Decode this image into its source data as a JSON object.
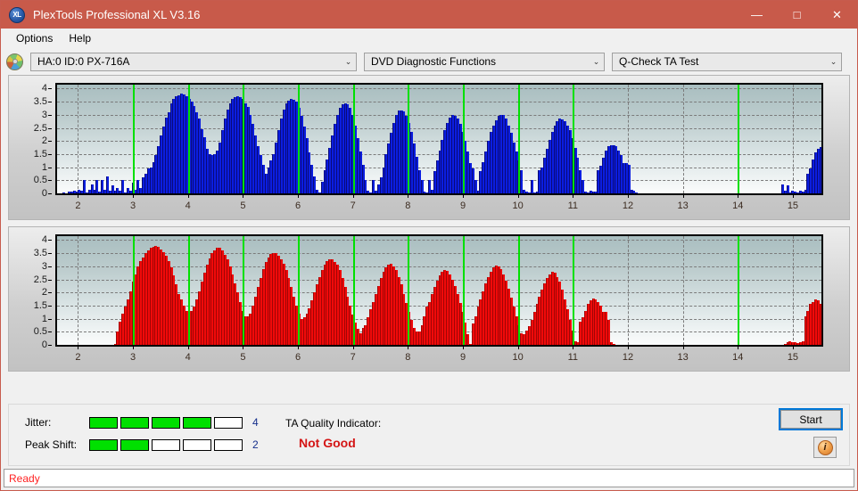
{
  "window": {
    "title": "PlexTools Professional XL V3.16",
    "icon": "app-xl-icon",
    "minimize": "—",
    "maximize": "□",
    "close": "✕"
  },
  "menubar": {
    "items": [
      {
        "label": "Options"
      },
      {
        "label": "Help"
      }
    ]
  },
  "selectors": {
    "drive": {
      "value": "HA:0 ID:0  PX-716A",
      "arrow": "⌄"
    },
    "function": {
      "value": "DVD Diagnostic Functions",
      "arrow": "⌄"
    },
    "test": {
      "value": "Q-Check TA Test",
      "arrow": "⌄"
    }
  },
  "chart_data": [
    {
      "type": "bar",
      "name": "ta-test-chart-jitter",
      "title": "",
      "xlabel": "",
      "ylabel": "",
      "color": "#0b1ee0",
      "xlim": [
        1.62,
        15.52
      ],
      "ylim": [
        0,
        4.15
      ],
      "yticks": [
        0,
        0.5,
        1,
        1.5,
        2,
        2.5,
        3,
        3.5,
        4
      ],
      "ytick_labels": [
        "0",
        "0.5",
        "1",
        "1.5",
        "2",
        "2.5",
        "3",
        "3.5",
        "4"
      ],
      "xticks": [
        2,
        3,
        4,
        5,
        6,
        7,
        8,
        9,
        10,
        11,
        12,
        13,
        14,
        15
      ],
      "xtick_labels": [
        "2",
        "3",
        "4",
        "5",
        "6",
        "7",
        "8",
        "9",
        "10",
        "11",
        "12",
        "13",
        "14",
        "15"
      ],
      "grid": true,
      "markers": [
        3,
        4,
        5,
        6,
        7,
        8,
        9,
        10,
        11,
        14
      ],
      "marker_color": "#00e000",
      "x_start": 1.72,
      "x_step": 0.0465,
      "values": [
        0.05,
        0.0,
        0.08,
        0.06,
        0.1,
        0.07,
        0.12,
        0.1,
        0.5,
        0.05,
        0.12,
        0.35,
        0.15,
        0.5,
        0.08,
        0.5,
        0.12,
        0.65,
        0.1,
        0.32,
        0.1,
        0.2,
        0.1,
        0.5,
        0.05,
        0.2,
        0.1,
        0.4,
        0.12,
        0.5,
        0.2,
        0.6,
        0.75,
        0.95,
        1.0,
        1.2,
        1.45,
        1.8,
        2.2,
        2.55,
        2.9,
        3.1,
        3.45,
        3.6,
        3.7,
        3.75,
        3.8,
        3.78,
        3.7,
        3.6,
        3.5,
        3.35,
        3.1,
        2.85,
        2.45,
        2.15,
        1.7,
        1.5,
        1.45,
        1.5,
        1.65,
        1.95,
        2.4,
        2.85,
        3.2,
        3.45,
        3.6,
        3.68,
        3.7,
        3.68,
        3.6,
        3.45,
        3.3,
        3.0,
        2.65,
        2.2,
        1.8,
        1.45,
        1.1,
        0.75,
        1.0,
        1.25,
        1.5,
        1.95,
        2.4,
        2.85,
        3.2,
        3.45,
        3.55,
        3.6,
        3.58,
        3.5,
        3.25,
        2.95,
        2.55,
        2.1,
        1.55,
        1.1,
        0.65,
        0.15,
        0.05,
        0.45,
        0.9,
        1.3,
        1.75,
        2.2,
        2.65,
        3.0,
        3.25,
        3.4,
        3.45,
        3.4,
        3.25,
        3.0,
        2.6,
        2.1,
        1.6,
        1.1,
        0.5,
        0.1,
        0.05,
        0.5,
        0.1,
        0.35,
        0.6,
        1.0,
        1.5,
        1.9,
        2.3,
        2.7,
        3.0,
        3.15,
        3.18,
        3.12,
        2.95,
        2.7,
        2.35,
        1.9,
        1.4,
        0.9,
        0.5,
        0.08,
        0.05,
        0.5,
        0.15,
        0.85,
        1.25,
        1.65,
        2.05,
        2.4,
        2.7,
        2.9,
        2.98,
        2.95,
        2.85,
        2.65,
        2.35,
        2.0,
        1.6,
        1.15,
        0.95,
        0.5,
        0.1,
        0.85,
        1.2,
        1.6,
        2.0,
        2.35,
        2.6,
        2.8,
        2.95,
        3.0,
        2.98,
        2.85,
        2.6,
        2.3,
        1.95,
        1.6,
        1.25,
        0.9,
        0.15,
        0.08,
        0.05,
        0.5,
        0.05,
        0.08,
        0.9,
        1.0,
        1.35,
        1.7,
        2.05,
        2.35,
        2.6,
        2.75,
        2.85,
        2.82,
        2.75,
        2.6,
        2.4,
        2.1,
        1.75,
        1.35,
        0.9,
        0.5,
        0.08,
        0.05,
        0.1,
        0.06,
        0.08,
        0.9,
        1.05,
        1.35,
        1.65,
        1.8,
        1.85,
        1.85,
        1.8,
        1.65,
        1.45,
        1.15,
        1.15,
        1.1,
        0.15,
        0.1,
        0.05,
        0.0,
        0.0,
        0.0,
        0.0,
        0.0,
        0.0,
        0.0,
        0.0,
        0.0,
        0.0,
        0.0,
        0.0,
        0.0,
        0.0,
        0.0,
        0.0,
        0.0,
        0.0,
        0.0,
        0.0,
        0.0,
        0.0,
        0.0,
        0.0,
        0.0,
        0.0,
        0.0,
        0.0,
        0.0,
        0.0,
        0.0,
        0.0,
        0.0,
        0.0,
        0.0,
        0.0,
        0.0,
        0.0,
        0.0,
        0.0,
        0.0,
        0.0,
        0.0,
        0.0,
        0.0,
        0.0,
        0.0,
        0.0,
        0.0,
        0.0,
        0.0,
        0.0,
        0.0,
        0.0,
        0.0,
        0.0,
        0.35,
        0.1,
        0.3,
        0.05,
        0.1,
        0.08,
        0.05,
        0.1,
        0.08,
        0.12,
        0.75,
        0.95,
        1.3,
        1.55,
        1.7,
        1.78,
        1.75,
        1.6,
        1.35,
        0.5,
        0.55,
        0.05,
        0.0,
        0.0,
        0.0,
        0.0,
        0.0,
        0.0,
        0.0,
        0.0,
        0.0,
        0.0,
        0.0,
        0.0,
        0.0,
        0.0,
        0.0,
        0.0,
        0.0,
        0.0,
        0.0,
        0.0,
        0.0,
        0.0,
        0.0,
        0.0,
        0.0,
        0.0,
        0.0,
        0.0,
        0.0
      ]
    },
    {
      "type": "bar",
      "name": "ta-test-chart-peak-shift",
      "title": "",
      "xlabel": "",
      "ylabel": "",
      "color": "#f00a0a",
      "xlim": [
        1.62,
        15.52
      ],
      "ylim": [
        0,
        4.15
      ],
      "yticks": [
        0,
        0.5,
        1,
        1.5,
        2,
        2.5,
        3,
        3.5,
        4
      ],
      "ytick_labels": [
        "0",
        "0.5",
        "1",
        "1.5",
        "2",
        "2.5",
        "3",
        "3.5",
        "4"
      ],
      "xticks": [
        2,
        3,
        4,
        5,
        6,
        7,
        8,
        9,
        10,
        11,
        12,
        13,
        14,
        15
      ],
      "xtick_labels": [
        "2",
        "3",
        "4",
        "5",
        "6",
        "7",
        "8",
        "9",
        "10",
        "11",
        "12",
        "13",
        "14",
        "15"
      ],
      "grid": true,
      "markers": [
        3,
        4,
        5,
        6,
        7,
        8,
        9,
        10,
        11,
        14
      ],
      "marker_color": "#00e000",
      "x_start": 1.72,
      "x_step": 0.0465,
      "values": [
        0.0,
        0.0,
        0.0,
        0.0,
        0.0,
        0.0,
        0.0,
        0.0,
        0.0,
        0.0,
        0.0,
        0.0,
        0.0,
        0.0,
        0.0,
        0.0,
        0.0,
        0.0,
        0.0,
        0.0,
        0.05,
        0.5,
        0.9,
        1.2,
        1.45,
        1.75,
        2.05,
        2.4,
        2.7,
        3.0,
        3.2,
        3.35,
        3.5,
        3.6,
        3.7,
        3.75,
        3.78,
        3.75,
        3.65,
        3.55,
        3.4,
        3.2,
        2.95,
        2.65,
        2.3,
        1.95,
        1.75,
        1.5,
        1.3,
        1.28,
        1.3,
        1.45,
        1.75,
        2.05,
        2.4,
        2.75,
        3.05,
        3.3,
        3.5,
        3.62,
        3.7,
        3.7,
        3.6,
        3.45,
        3.25,
        3.0,
        2.7,
        2.35,
        2.0,
        1.65,
        1.3,
        1.1,
        1.08,
        1.2,
        1.5,
        1.85,
        2.2,
        2.55,
        2.9,
        3.15,
        3.35,
        3.48,
        3.5,
        3.5,
        3.4,
        3.25,
        3.1,
        2.85,
        2.55,
        2.2,
        1.85,
        1.5,
        1.2,
        1.0,
        1.05,
        1.2,
        1.4,
        1.7,
        2.0,
        2.3,
        2.6,
        2.85,
        3.05,
        3.2,
        3.25,
        3.25,
        3.15,
        3.05,
        2.85,
        2.55,
        2.2,
        1.85,
        1.5,
        1.15,
        0.85,
        0.6,
        0.45,
        0.65,
        0.75,
        1.05,
        1.35,
        1.65,
        1.95,
        2.25,
        2.55,
        2.8,
        2.95,
        3.05,
        3.08,
        3.0,
        2.85,
        2.6,
        2.3,
        1.95,
        1.6,
        1.25,
        0.95,
        0.65,
        0.5,
        0.52,
        0.75,
        1.1,
        1.45,
        1.65,
        1.95,
        2.2,
        2.45,
        2.65,
        2.78,
        2.85,
        2.82,
        2.7,
        2.5,
        2.25,
        1.95,
        1.6,
        1.25,
        0.85,
        0.4,
        0.05,
        0.8,
        1.1,
        1.45,
        1.75,
        2.05,
        2.35,
        2.6,
        2.8,
        2.95,
        3.02,
        3.0,
        2.9,
        2.7,
        2.45,
        2.15,
        1.8,
        1.45,
        1.1,
        0.75,
        0.45,
        0.4,
        0.55,
        0.7,
        0.95,
        1.25,
        1.55,
        1.85,
        2.1,
        2.35,
        2.55,
        2.7,
        2.78,
        2.75,
        2.6,
        2.4,
        2.1,
        1.75,
        1.35,
        0.95,
        0.55,
        0.15,
        0.1,
        0.9,
        1.05,
        1.3,
        1.55,
        1.7,
        1.78,
        1.75,
        1.65,
        1.5,
        1.25,
        1.25,
        0.95,
        0.1,
        0.05,
        0.0,
        0.0,
        0.0,
        0.0,
        0.0,
        0.0,
        0.0,
        0.0,
        0.0,
        0.0,
        0.0,
        0.0,
        0.0,
        0.0,
        0.0,
        0.0,
        0.0,
        0.0,
        0.0,
        0.0,
        0.0,
        0.0,
        0.0,
        0.0,
        0.0,
        0.0,
        0.0,
        0.0,
        0.0,
        0.0,
        0.0,
        0.0,
        0.0,
        0.0,
        0.0,
        0.0,
        0.0,
        0.0,
        0.0,
        0.0,
        0.0,
        0.0,
        0.0,
        0.0,
        0.0,
        0.0,
        0.0,
        0.0,
        0.0,
        0.0,
        0.0,
        0.0,
        0.0,
        0.0,
        0.0,
        0.0,
        0.0,
        0.0,
        0.0,
        0.0,
        0.0,
        0.0,
        0.0,
        0.0,
        0.0,
        0.0,
        0.05,
        0.1,
        0.12,
        0.1,
        0.1,
        0.08,
        0.1,
        0.12,
        1.1,
        1.3,
        1.55,
        1.65,
        1.72,
        1.7,
        1.55,
        1.35,
        1.1,
        0.8,
        0.75,
        0.45,
        0.4,
        0.05,
        0.0,
        0.0,
        0.0,
        0.0,
        0.0,
        0.0,
        0.0,
        0.0,
        0.0,
        0.0,
        0.0,
        0.0,
        0.0,
        0.0,
        0.0,
        0.0,
        0.0,
        0.0,
        0.0,
        0.0,
        0.0,
        0.0,
        0.0,
        0.0,
        0.0,
        0.0,
        0.0,
        0.0,
        0.0,
        0.0
      ]
    }
  ],
  "bottom": {
    "jitter": {
      "label": "Jitter:",
      "filled": 4,
      "total": 5,
      "value": "4"
    },
    "peak_shift": {
      "label": "Peak Shift:",
      "filled": 2,
      "total": 5,
      "value": "2"
    },
    "ta_quality": {
      "label": "TA Quality Indicator:",
      "value": "Not Good",
      "value_color": "#d41616"
    },
    "start_button": {
      "label": "Start"
    },
    "info_button": {
      "label": "i"
    }
  },
  "statusbar": {
    "text": "Ready"
  }
}
